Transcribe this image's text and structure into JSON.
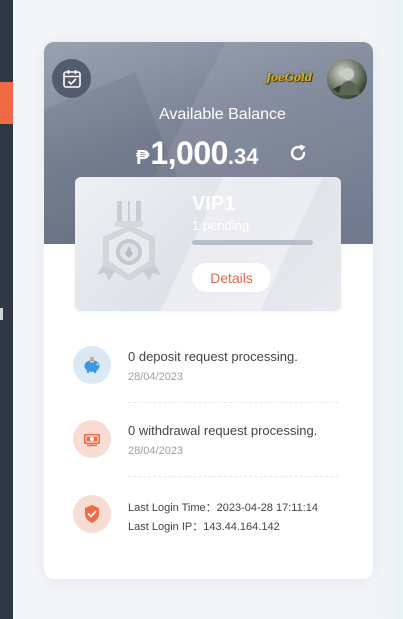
{
  "wallet": {
    "balance_label": "Available Balance",
    "currency_symbol": "₱",
    "balance_integer": "1,000",
    "balance_decimal": ".34",
    "logo_text": "JoeGold"
  },
  "vip": {
    "level": "VIP1",
    "pending_text": "1 pending",
    "progress": 0,
    "details_label": "Details"
  },
  "activity": {
    "deposit": {
      "text": "0 deposit request processing.",
      "date": "28/04/2023",
      "icon": "piggy-bank-icon",
      "color": "#3b98e0"
    },
    "withdrawal": {
      "text": "0 withdrawal request processing.",
      "date": "28/04/2023",
      "icon": "cash-icon",
      "color": "#ee6b46"
    },
    "login": {
      "time_label": "Last Login Time：",
      "time_value": "2023-04-28 17:11:14",
      "ip_label": "Last Login IP：",
      "ip_value": "143.44.164.142",
      "icon": "shield-check-icon",
      "color": "#ee6b46"
    }
  },
  "colors": {
    "accent": "#ee6b46",
    "rail": "#2f3845",
    "hero_dark": "#646d82"
  }
}
